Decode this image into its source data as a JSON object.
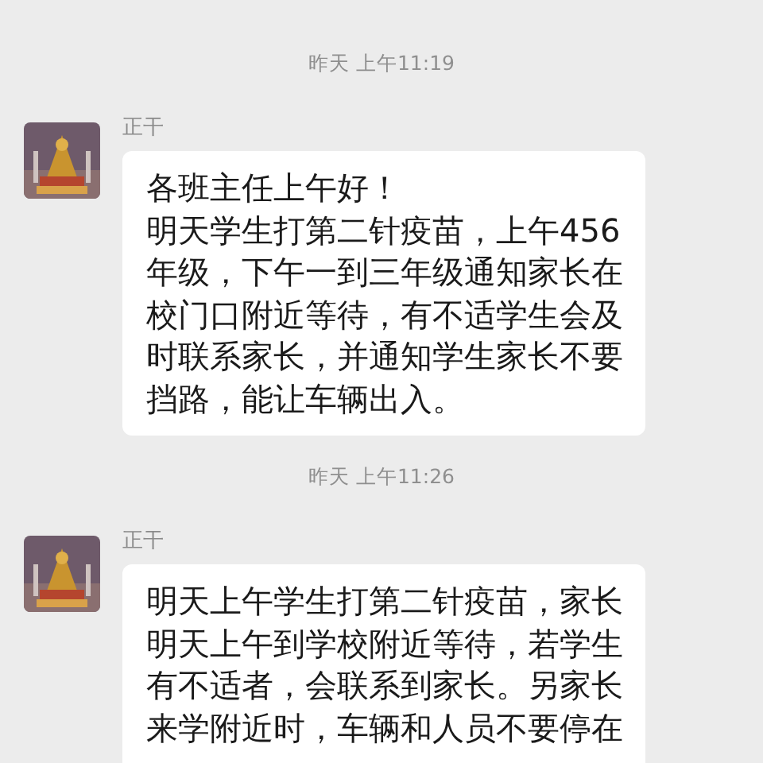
{
  "messages": [
    {
      "time": "昨天 上午11:19",
      "sender": "正干",
      "paragraphs": [
        "各班主任上午好！",
        "明天学生打第二针疫苗，上午456年级，下午一到三年级通知家长在校门口附近等待，有不适学生会及时联系家长，并通知学生家长不要挡路，能让车辆出入。"
      ]
    },
    {
      "time": "昨天 上午11:26",
      "sender": "正干",
      "paragraphs": [
        "明天上午学生打第二针疫苗，家长明天上午到学校附近等待，若学生有不适者，会联系到家长。另家长来学附近时，车辆和人员不要停在"
      ]
    }
  ]
}
